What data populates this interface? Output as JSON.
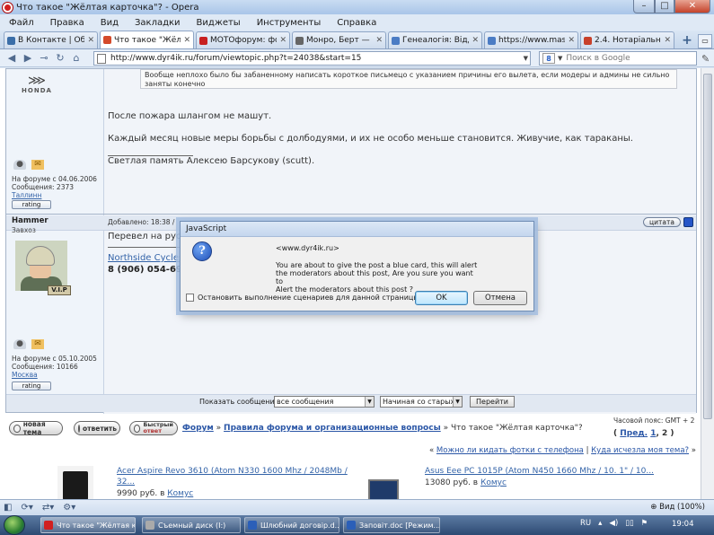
{
  "window": {
    "title": "Что такое \"Жёлтая карточка\"? - Opera",
    "minimize": "–",
    "maximize": "□",
    "close": "✕"
  },
  "menu": [
    "Файл",
    "Правка",
    "Вид",
    "Закладки",
    "Виджеты",
    "Инструменты",
    "Справка"
  ],
  "tabs": [
    {
      "label": "В Контакте | Обсу...",
      "color": "#3b6ea8",
      "active": false
    },
    {
      "label": "Что такое \"Жёлта...",
      "color": "#d44a2a",
      "active": true
    },
    {
      "label": "MOTOфорум: фо...",
      "color": "#c82020",
      "active": false
    },
    {
      "label": "Монро, Берт — В...",
      "color": "#666666",
      "active": false
    },
    {
      "label": "Генеалогія: Відділ...",
      "color": "#4b7cc4",
      "active": false
    },
    {
      "label": "https://www.mast...",
      "color": "#4b7cc4",
      "active": false
    },
    {
      "label": "2.4. Нотаріальна п...",
      "color": "#c8402a",
      "active": false
    }
  ],
  "address": {
    "url": "http://www.dyr4ik.ru/forum/viewtopic.php?t=24038&start=15",
    "search_placeholder": "Поиск в Google",
    "search_engine_icon": "8"
  },
  "post1": {
    "quote_line1": "Вообще неплохо было бы забаненному написать короткое письмецо с указанием причины его вылета, если модеры и админы не сильно",
    "quote_line2": "заняты конечно",
    "brand": "HONDA",
    "line1": "После пожара шлангом не машут.",
    "line2": "Каждый месяц новые меры борьбы с долбодуями, и их не особо меньше становится. Живучие, как тараканы.",
    "line3": "Светлая память Алексею Барсукову (scutt).",
    "user_joined": "На форуме с 04.06.2006",
    "user_posts": "Сообщения: 2373",
    "user_city": "Таллинн",
    "rating": "rating"
  },
  "post2": {
    "author": "Hammer",
    "rank": "Завхоз",
    "added": "Добавлено: 18:38 /",
    "cite": "цитата",
    "text": "Перевел на русс",
    "link": "Northside Cycles -",
    "phone": "8 (906) 054-69-",
    "badge": "V.I.P",
    "user_joined": "На форуме с 05.10.2005",
    "user_posts": "Сообщения: 10166",
    "user_city": "Москва",
    "rating": "rating"
  },
  "filter": {
    "label": "Показать сообщения:",
    "option1": "все сообщения",
    "option2": "Начиная со старых",
    "go": "Перейти"
  },
  "actions": {
    "new_topic": "новая тема",
    "reply": "ответить",
    "quick_reply_top": "Быстрый",
    "quick_reply_bottom": "ответ"
  },
  "breadcrumb": {
    "forum": "Форум",
    "sep": "»",
    "section": "Правила форума и организационные вопросы",
    "topic": "» Что такое \"Жёлтая карточка\"?"
  },
  "tz": "Часовой пояс: GMT + 2",
  "pager": {
    "prefix": "(",
    "prev": "Пред.",
    "page1": "1",
    "sep": ",",
    "page2": "2",
    "suffix": ")"
  },
  "nav": {
    "prev_topic": "Можно ли кидать фотки с телефона",
    "divider": "|",
    "next_topic": "Куда исчезла моя тема?",
    "lead": "«",
    "tail": "»"
  },
  "ads": [
    {
      "title1": "Acer Aspire Revo 3610 (Atom N330 1600 Mhz / 2048Mb /",
      "title2": "32...",
      "price": "9990 руб. в",
      "shop": "Комус"
    },
    {
      "title1": "Asus Eee PC 1015P (Atom N450 1660 Mhz / 10. 1\" / 10...",
      "price": "13080 руб. в",
      "shop": "Комус"
    }
  ],
  "dialog": {
    "title": "JavaScript",
    "site": "<www.dyr4ik.ru>",
    "message_line1": "You are about to give the post a blue card, this will alert",
    "message_line2": "the moderators about this post, Are you sure you want to",
    "message_line3": "Alert the moderators about this post ?",
    "checkbox": "Остановить выполнение сценариев для данной страницы",
    "ok": "OK",
    "cancel": "Отмена"
  },
  "status": {
    "zoom": "Вид (100%)"
  },
  "taskbar": {
    "items": [
      {
        "label": "Что такое \"Жёлтая к...",
        "color": "#d12020"
      },
      {
        "label": "Съемный диск (I:)",
        "color": "#aaaaaa"
      },
      {
        "label": "Шлюбний договір.d...",
        "color": "#2b5fb8"
      },
      {
        "label": "Заповіт.doc [Режим...",
        "color": "#2b5fb8"
      }
    ],
    "lang": "RU",
    "clock": "19:04"
  }
}
